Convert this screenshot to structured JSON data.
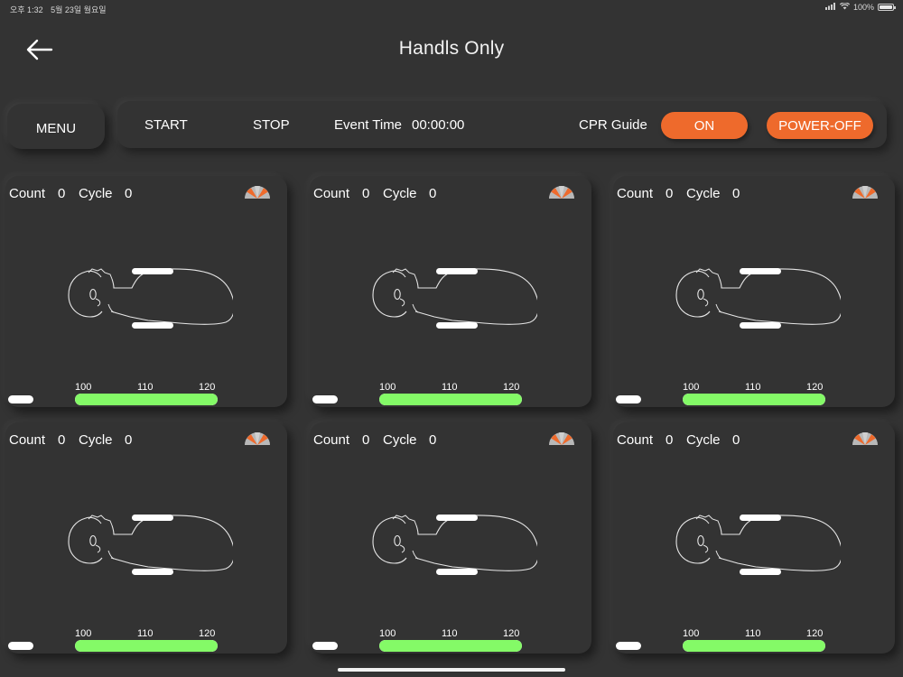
{
  "status_bar": {
    "time": "오후 1:32",
    "date": "5월 23일 월요일",
    "battery": "100%"
  },
  "header": {
    "title": "Handls Only",
    "back_icon": "arrow-left-icon"
  },
  "toolbar": {
    "menu_label": "MENU",
    "start_label": "START",
    "stop_label": "STOP",
    "event_time_label": "Event Time",
    "event_time_value": "00:00:00",
    "cpr_guide_label": "CPR Guide",
    "on_label": "ON",
    "power_off_label": "POWER-OFF"
  },
  "colors": {
    "accent": "#ee6a2c",
    "rate_green": "#84fa67",
    "background": "#333333"
  },
  "cards": [
    {
      "count_label": "Count",
      "count": "0",
      "cycle_label": "Cycle",
      "cycle": "0",
      "scale": [
        "100",
        "110",
        "120"
      ],
      "rate_fill": 1.0
    },
    {
      "count_label": "Count",
      "count": "0",
      "cycle_label": "Cycle",
      "cycle": "0",
      "scale": [
        "100",
        "110",
        "120"
      ],
      "rate_fill": 1.0
    },
    {
      "count_label": "Count",
      "count": "0",
      "cycle_label": "Cycle",
      "cycle": "0",
      "scale": [
        "100",
        "110",
        "120"
      ],
      "rate_fill": 1.0
    },
    {
      "count_label": "Count",
      "count": "0",
      "cycle_label": "Cycle",
      "cycle": "0",
      "scale": [
        "100",
        "110",
        "120"
      ],
      "rate_fill": 1.0
    },
    {
      "count_label": "Count",
      "count": "0",
      "cycle_label": "Cycle",
      "cycle": "0",
      "scale": [
        "100",
        "110",
        "120"
      ],
      "rate_fill": 1.0
    },
    {
      "count_label": "Count",
      "count": "0",
      "cycle_label": "Cycle",
      "cycle": "0",
      "scale": [
        "100",
        "110",
        "120"
      ],
      "rate_fill": 1.0
    }
  ]
}
